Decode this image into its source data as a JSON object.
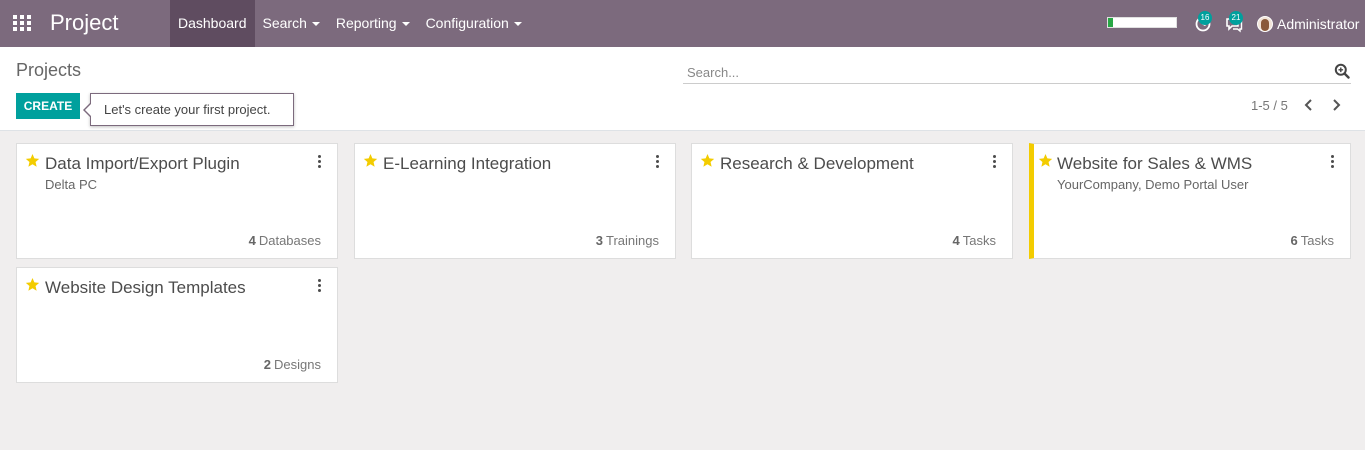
{
  "navbar": {
    "brand": "Project",
    "menu": [
      {
        "label": "Dashboard",
        "active": true,
        "dropdown": false
      },
      {
        "label": "Search",
        "active": false,
        "dropdown": true
      },
      {
        "label": "Reporting",
        "active": false,
        "dropdown": true
      },
      {
        "label": "Configuration",
        "active": false,
        "dropdown": true
      }
    ],
    "systray": {
      "progress_fraction": 0.07,
      "activity_count": "16",
      "messages_count": "21",
      "user_name": "Administrator"
    },
    "colors": {
      "bar": "#7c6a7d",
      "active_item": "#5f4c60"
    }
  },
  "control_panel": {
    "title": "Projects",
    "search_placeholder": "Search...",
    "create_label": "CREATE",
    "tooltip": "Let's create your first project.",
    "pager": "1-5 / 5",
    "accent": "#00a09d"
  },
  "projects": [
    {
      "name": "Data Import/Export Plugin",
      "partner": "Delta PC",
      "count": "4",
      "count_label": "Databases",
      "favorite": true,
      "highlight": false
    },
    {
      "name": "E-Learning Integration",
      "partner": "",
      "count": "3",
      "count_label": "Trainings",
      "favorite": true,
      "highlight": false
    },
    {
      "name": "Research & Development",
      "partner": "",
      "count": "4",
      "count_label": "Tasks",
      "favorite": true,
      "highlight": false
    },
    {
      "name": "Website for Sales & WMS",
      "partner": "YourCompany, Demo Portal User",
      "count": "6",
      "count_label": "Tasks",
      "favorite": true,
      "highlight": true
    },
    {
      "name": "Website Design Templates",
      "partner": "",
      "count": "2",
      "count_label": "Designs",
      "favorite": true,
      "highlight": false
    }
  ],
  "icons": [
    "apps-grid-icon",
    "caret-down-icon",
    "clock-icon",
    "chat-icon",
    "avatar",
    "search-zoom-icon",
    "chevron-left-icon",
    "chevron-right-icon",
    "star-icon",
    "kebab-menu-icon"
  ],
  "highlight_color": "#f3cc00"
}
